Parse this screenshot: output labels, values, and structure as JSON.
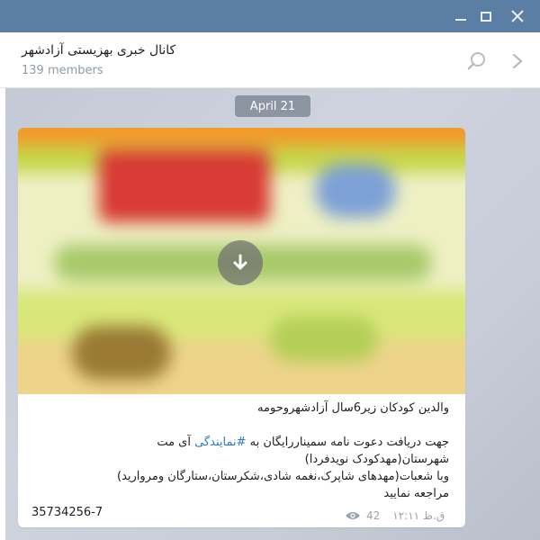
{
  "window": {
    "minimize_icon": "minimize-icon",
    "maximize_icon": "maximize-icon",
    "close_icon": "close-icon"
  },
  "header": {
    "title": "کانال خبری بهزیستی آزادشهر",
    "subtitle": "139 members"
  },
  "chat": {
    "date": "April 21",
    "message": {
      "caption_lines": [
        "والدین کودکان زیر6سال آزادشهروحومه",
        "",
        "جهت دریافت دعوت نامه سمیناررایگان به",
        "شهرستان(مهدکودک نویدفردا)",
        "وبا شعبات(مهدهای شاپرک،نغمه شادی،شکرستان،ستارگان ومروارید)",
        "مراجعه نمایید"
      ],
      "hashtag": "#نمایندگی",
      "hashtag_suffix": " آی مت",
      "phone": "35734256-7",
      "views": "42",
      "time": "ق.ظ ۱۲:۱۱"
    }
  },
  "colors": {
    "titlebar": "#5b7fa4",
    "link": "#2a7cc7",
    "meta": "#9aa4ad"
  }
}
